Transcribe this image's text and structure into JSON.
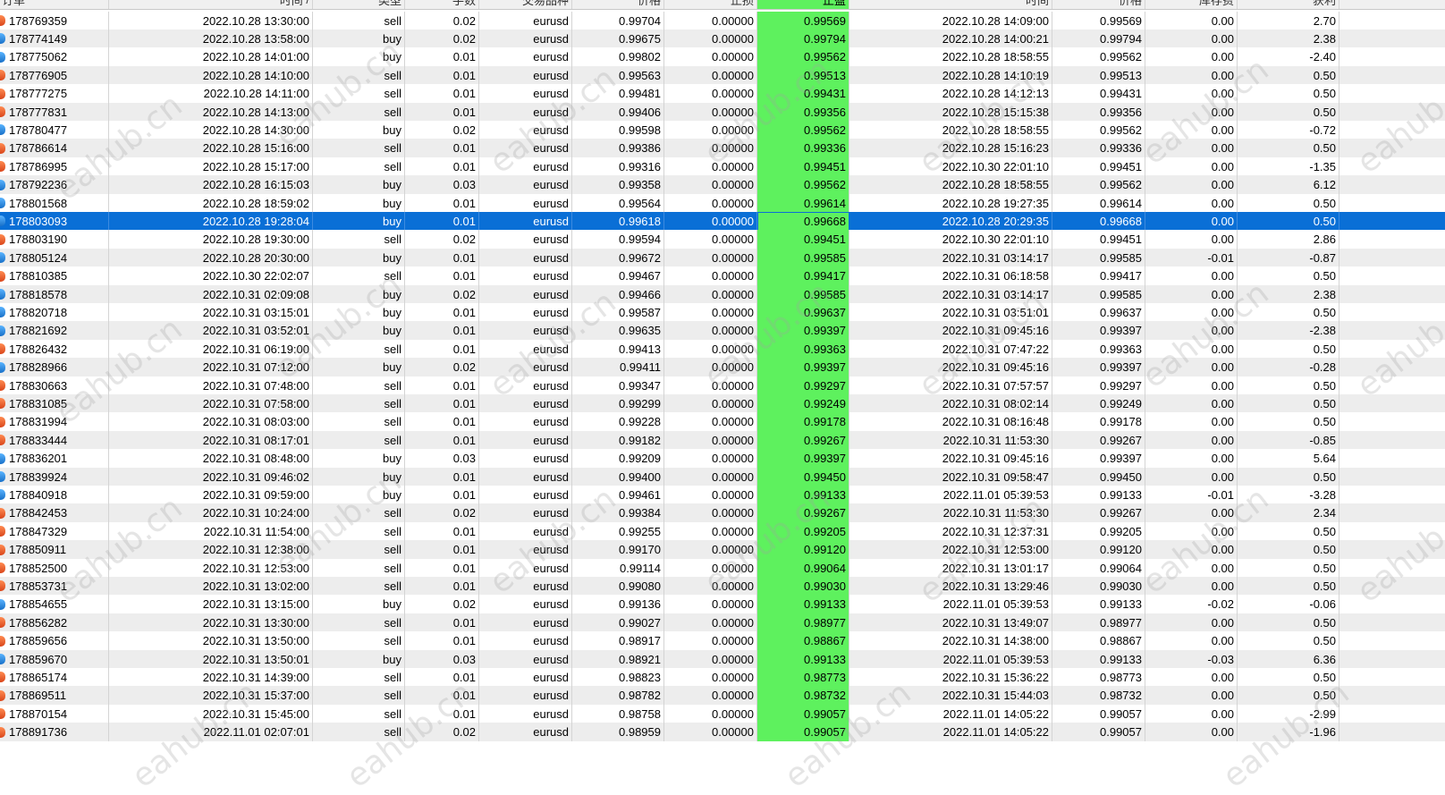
{
  "columns": [
    "订单",
    "时间",
    "类型",
    "手数",
    "交易品种",
    "价格",
    "止损",
    "止盈",
    "时间",
    "价格",
    "库存费",
    "获利",
    ""
  ],
  "columns_visible_note": "",
  "sort_indicator": "/",
  "selected_row_index": 11,
  "colors": {
    "takeprofit_bg": "#5ef15e",
    "selected_bg": "#0a6fd6",
    "sell_icon": "#e05a24",
    "buy_icon": "#2a86e0"
  },
  "watermark_text": "eahub.cn",
  "rows": [
    {
      "order": "178769359",
      "open_time": "2022.10.28 13:30:00",
      "type": "sell",
      "lots": "0.02",
      "symbol": "eurusd",
      "open_price": "0.99704",
      "sl": "0.00000",
      "tp": "0.99569",
      "close_time": "2022.10.28 14:09:00",
      "close_price": "0.99569",
      "swap": "0.00",
      "profit": "2.70"
    },
    {
      "order": "178774149",
      "open_time": "2022.10.28 13:58:00",
      "type": "buy",
      "lots": "0.02",
      "symbol": "eurusd",
      "open_price": "0.99675",
      "sl": "0.00000",
      "tp": "0.99794",
      "close_time": "2022.10.28 14:00:21",
      "close_price": "0.99794",
      "swap": "0.00",
      "profit": "2.38"
    },
    {
      "order": "178775062",
      "open_time": "2022.10.28 14:01:00",
      "type": "buy",
      "lots": "0.01",
      "symbol": "eurusd",
      "open_price": "0.99802",
      "sl": "0.00000",
      "tp": "0.99562",
      "close_time": "2022.10.28 18:58:55",
      "close_price": "0.99562",
      "swap": "0.00",
      "profit": "-2.40"
    },
    {
      "order": "178776905",
      "open_time": "2022.10.28 14:10:00",
      "type": "sell",
      "lots": "0.01",
      "symbol": "eurusd",
      "open_price": "0.99563",
      "sl": "0.00000",
      "tp": "0.99513",
      "close_time": "2022.10.28 14:10:19",
      "close_price": "0.99513",
      "swap": "0.00",
      "profit": "0.50"
    },
    {
      "order": "178777275",
      "open_time": "2022.10.28 14:11:00",
      "type": "sell",
      "lots": "0.01",
      "symbol": "eurusd",
      "open_price": "0.99481",
      "sl": "0.00000",
      "tp": "0.99431",
      "close_time": "2022.10.28 14:12:13",
      "close_price": "0.99431",
      "swap": "0.00",
      "profit": "0.50"
    },
    {
      "order": "178777831",
      "open_time": "2022.10.28 14:13:00",
      "type": "sell",
      "lots": "0.01",
      "symbol": "eurusd",
      "open_price": "0.99406",
      "sl": "0.00000",
      "tp": "0.99356",
      "close_time": "2022.10.28 15:15:38",
      "close_price": "0.99356",
      "swap": "0.00",
      "profit": "0.50"
    },
    {
      "order": "178780477",
      "open_time": "2022.10.28 14:30:00",
      "type": "buy",
      "lots": "0.02",
      "symbol": "eurusd",
      "open_price": "0.99598",
      "sl": "0.00000",
      "tp": "0.99562",
      "close_time": "2022.10.28 18:58:55",
      "close_price": "0.99562",
      "swap": "0.00",
      "profit": "-0.72"
    },
    {
      "order": "178786614",
      "open_time": "2022.10.28 15:16:00",
      "type": "sell",
      "lots": "0.01",
      "symbol": "eurusd",
      "open_price": "0.99386",
      "sl": "0.00000",
      "tp": "0.99336",
      "close_time": "2022.10.28 15:16:23",
      "close_price": "0.99336",
      "swap": "0.00",
      "profit": "0.50"
    },
    {
      "order": "178786995",
      "open_time": "2022.10.28 15:17:00",
      "type": "sell",
      "lots": "0.01",
      "symbol": "eurusd",
      "open_price": "0.99316",
      "sl": "0.00000",
      "tp": "0.99451",
      "close_time": "2022.10.30 22:01:10",
      "close_price": "0.99451",
      "swap": "0.00",
      "profit": "-1.35"
    },
    {
      "order": "178792236",
      "open_time": "2022.10.28 16:15:03",
      "type": "buy",
      "lots": "0.03",
      "symbol": "eurusd",
      "open_price": "0.99358",
      "sl": "0.00000",
      "tp": "0.99562",
      "close_time": "2022.10.28 18:58:55",
      "close_price": "0.99562",
      "swap": "0.00",
      "profit": "6.12"
    },
    {
      "order": "178801568",
      "open_time": "2022.10.28 18:59:02",
      "type": "buy",
      "lots": "0.01",
      "symbol": "eurusd",
      "open_price": "0.99564",
      "sl": "0.00000",
      "tp": "0.99614",
      "close_time": "2022.10.28 19:27:35",
      "close_price": "0.99614",
      "swap": "0.00",
      "profit": "0.50"
    },
    {
      "order": "178803093",
      "open_time": "2022.10.28 19:28:04",
      "type": "buy",
      "lots": "0.01",
      "symbol": "eurusd",
      "open_price": "0.99618",
      "sl": "0.00000",
      "tp": "0.99668",
      "close_time": "2022.10.28 20:29:35",
      "close_price": "0.99668",
      "swap": "0.00",
      "profit": "0.50"
    },
    {
      "order": "178803190",
      "open_time": "2022.10.28 19:30:00",
      "type": "sell",
      "lots": "0.02",
      "symbol": "eurusd",
      "open_price": "0.99594",
      "sl": "0.00000",
      "tp": "0.99451",
      "close_time": "2022.10.30 22:01:10",
      "close_price": "0.99451",
      "swap": "0.00",
      "profit": "2.86"
    },
    {
      "order": "178805124",
      "open_time": "2022.10.28 20:30:00",
      "type": "buy",
      "lots": "0.01",
      "symbol": "eurusd",
      "open_price": "0.99672",
      "sl": "0.00000",
      "tp": "0.99585",
      "close_time": "2022.10.31 03:14:17",
      "close_price": "0.99585",
      "swap": "-0.01",
      "profit": "-0.87"
    },
    {
      "order": "178810385",
      "open_time": "2022.10.30 22:02:07",
      "type": "sell",
      "lots": "0.01",
      "symbol": "eurusd",
      "open_price": "0.99467",
      "sl": "0.00000",
      "tp": "0.99417",
      "close_time": "2022.10.31 06:18:58",
      "close_price": "0.99417",
      "swap": "0.00",
      "profit": "0.50"
    },
    {
      "order": "178818578",
      "open_time": "2022.10.31 02:09:08",
      "type": "buy",
      "lots": "0.02",
      "symbol": "eurusd",
      "open_price": "0.99466",
      "sl": "0.00000",
      "tp": "0.99585",
      "close_time": "2022.10.31 03:14:17",
      "close_price": "0.99585",
      "swap": "0.00",
      "profit": "2.38"
    },
    {
      "order": "178820718",
      "open_time": "2022.10.31 03:15:01",
      "type": "buy",
      "lots": "0.01",
      "symbol": "eurusd",
      "open_price": "0.99587",
      "sl": "0.00000",
      "tp": "0.99637",
      "close_time": "2022.10.31 03:51:01",
      "close_price": "0.99637",
      "swap": "0.00",
      "profit": "0.50"
    },
    {
      "order": "178821692",
      "open_time": "2022.10.31 03:52:01",
      "type": "buy",
      "lots": "0.01",
      "symbol": "eurusd",
      "open_price": "0.99635",
      "sl": "0.00000",
      "tp": "0.99397",
      "close_time": "2022.10.31 09:45:16",
      "close_price": "0.99397",
      "swap": "0.00",
      "profit": "-2.38"
    },
    {
      "order": "178826432",
      "open_time": "2022.10.31 06:19:00",
      "type": "sell",
      "lots": "0.01",
      "symbol": "eurusd",
      "open_price": "0.99413",
      "sl": "0.00000",
      "tp": "0.99363",
      "close_time": "2022.10.31 07:47:22",
      "close_price": "0.99363",
      "swap": "0.00",
      "profit": "0.50"
    },
    {
      "order": "178828966",
      "open_time": "2022.10.31 07:12:00",
      "type": "buy",
      "lots": "0.02",
      "symbol": "eurusd",
      "open_price": "0.99411",
      "sl": "0.00000",
      "tp": "0.99397",
      "close_time": "2022.10.31 09:45:16",
      "close_price": "0.99397",
      "swap": "0.00",
      "profit": "-0.28"
    },
    {
      "order": "178830663",
      "open_time": "2022.10.31 07:48:00",
      "type": "sell",
      "lots": "0.01",
      "symbol": "eurusd",
      "open_price": "0.99347",
      "sl": "0.00000",
      "tp": "0.99297",
      "close_time": "2022.10.31 07:57:57",
      "close_price": "0.99297",
      "swap": "0.00",
      "profit": "0.50"
    },
    {
      "order": "178831085",
      "open_time": "2022.10.31 07:58:00",
      "type": "sell",
      "lots": "0.01",
      "symbol": "eurusd",
      "open_price": "0.99299",
      "sl": "0.00000",
      "tp": "0.99249",
      "close_time": "2022.10.31 08:02:14",
      "close_price": "0.99249",
      "swap": "0.00",
      "profit": "0.50"
    },
    {
      "order": "178831994",
      "open_time": "2022.10.31 08:03:00",
      "type": "sell",
      "lots": "0.01",
      "symbol": "eurusd",
      "open_price": "0.99228",
      "sl": "0.00000",
      "tp": "0.99178",
      "close_time": "2022.10.31 08:16:48",
      "close_price": "0.99178",
      "swap": "0.00",
      "profit": "0.50"
    },
    {
      "order": "178833444",
      "open_time": "2022.10.31 08:17:01",
      "type": "sell",
      "lots": "0.01",
      "symbol": "eurusd",
      "open_price": "0.99182",
      "sl": "0.00000",
      "tp": "0.99267",
      "close_time": "2022.10.31 11:53:30",
      "close_price": "0.99267",
      "swap": "0.00",
      "profit": "-0.85"
    },
    {
      "order": "178836201",
      "open_time": "2022.10.31 08:48:00",
      "type": "buy",
      "lots": "0.03",
      "symbol": "eurusd",
      "open_price": "0.99209",
      "sl": "0.00000",
      "tp": "0.99397",
      "close_time": "2022.10.31 09:45:16",
      "close_price": "0.99397",
      "swap": "0.00",
      "profit": "5.64"
    },
    {
      "order": "178839924",
      "open_time": "2022.10.31 09:46:02",
      "type": "buy",
      "lots": "0.01",
      "symbol": "eurusd",
      "open_price": "0.99400",
      "sl": "0.00000",
      "tp": "0.99450",
      "close_time": "2022.10.31 09:58:47",
      "close_price": "0.99450",
      "swap": "0.00",
      "profit": "0.50"
    },
    {
      "order": "178840918",
      "open_time": "2022.10.31 09:59:00",
      "type": "buy",
      "lots": "0.01",
      "symbol": "eurusd",
      "open_price": "0.99461",
      "sl": "0.00000",
      "tp": "0.99133",
      "close_time": "2022.11.01 05:39:53",
      "close_price": "0.99133",
      "swap": "-0.01",
      "profit": "-3.28"
    },
    {
      "order": "178842453",
      "open_time": "2022.10.31 10:24:00",
      "type": "sell",
      "lots": "0.02",
      "symbol": "eurusd",
      "open_price": "0.99384",
      "sl": "0.00000",
      "tp": "0.99267",
      "close_time": "2022.10.31 11:53:30",
      "close_price": "0.99267",
      "swap": "0.00",
      "profit": "2.34"
    },
    {
      "order": "178847329",
      "open_time": "2022.10.31 11:54:00",
      "type": "sell",
      "lots": "0.01",
      "symbol": "eurusd",
      "open_price": "0.99255",
      "sl": "0.00000",
      "tp": "0.99205",
      "close_time": "2022.10.31 12:37:31",
      "close_price": "0.99205",
      "swap": "0.00",
      "profit": "0.50"
    },
    {
      "order": "178850911",
      "open_time": "2022.10.31 12:38:00",
      "type": "sell",
      "lots": "0.01",
      "symbol": "eurusd",
      "open_price": "0.99170",
      "sl": "0.00000",
      "tp": "0.99120",
      "close_time": "2022.10.31 12:53:00",
      "close_price": "0.99120",
      "swap": "0.00",
      "profit": "0.50"
    },
    {
      "order": "178852500",
      "open_time": "2022.10.31 12:53:00",
      "type": "sell",
      "lots": "0.01",
      "symbol": "eurusd",
      "open_price": "0.99114",
      "sl": "0.00000",
      "tp": "0.99064",
      "close_time": "2022.10.31 13:01:17",
      "close_price": "0.99064",
      "swap": "0.00",
      "profit": "0.50"
    },
    {
      "order": "178853731",
      "open_time": "2022.10.31 13:02:00",
      "type": "sell",
      "lots": "0.01",
      "symbol": "eurusd",
      "open_price": "0.99080",
      "sl": "0.00000",
      "tp": "0.99030",
      "close_time": "2022.10.31 13:29:46",
      "close_price": "0.99030",
      "swap": "0.00",
      "profit": "0.50"
    },
    {
      "order": "178854655",
      "open_time": "2022.10.31 13:15:00",
      "type": "buy",
      "lots": "0.02",
      "symbol": "eurusd",
      "open_price": "0.99136",
      "sl": "0.00000",
      "tp": "0.99133",
      "close_time": "2022.11.01 05:39:53",
      "close_price": "0.99133",
      "swap": "-0.02",
      "profit": "-0.06"
    },
    {
      "order": "178856282",
      "open_time": "2022.10.31 13:30:00",
      "type": "sell",
      "lots": "0.01",
      "symbol": "eurusd",
      "open_price": "0.99027",
      "sl": "0.00000",
      "tp": "0.98977",
      "close_time": "2022.10.31 13:49:07",
      "close_price": "0.98977",
      "swap": "0.00",
      "profit": "0.50"
    },
    {
      "order": "178859656",
      "open_time": "2022.10.31 13:50:00",
      "type": "sell",
      "lots": "0.01",
      "symbol": "eurusd",
      "open_price": "0.98917",
      "sl": "0.00000",
      "tp": "0.98867",
      "close_time": "2022.10.31 14:38:00",
      "close_price": "0.98867",
      "swap": "0.00",
      "profit": "0.50"
    },
    {
      "order": "178859670",
      "open_time": "2022.10.31 13:50:01",
      "type": "buy",
      "lots": "0.03",
      "symbol": "eurusd",
      "open_price": "0.98921",
      "sl": "0.00000",
      "tp": "0.99133",
      "close_time": "2022.11.01 05:39:53",
      "close_price": "0.99133",
      "swap": "-0.03",
      "profit": "6.36"
    },
    {
      "order": "178865174",
      "open_time": "2022.10.31 14:39:00",
      "type": "sell",
      "lots": "0.01",
      "symbol": "eurusd",
      "open_price": "0.98823",
      "sl": "0.00000",
      "tp": "0.98773",
      "close_time": "2022.10.31 15:36:22",
      "close_price": "0.98773",
      "swap": "0.00",
      "profit": "0.50"
    },
    {
      "order": "178869511",
      "open_time": "2022.10.31 15:37:00",
      "type": "sell",
      "lots": "0.01",
      "symbol": "eurusd",
      "open_price": "0.98782",
      "sl": "0.00000",
      "tp": "0.98732",
      "close_time": "2022.10.31 15:44:03",
      "close_price": "0.98732",
      "swap": "0.00",
      "profit": "0.50"
    },
    {
      "order": "178870154",
      "open_time": "2022.10.31 15:45:00",
      "type": "sell",
      "lots": "0.01",
      "symbol": "eurusd",
      "open_price": "0.98758",
      "sl": "0.00000",
      "tp": "0.99057",
      "close_time": "2022.11.01 14:05:22",
      "close_price": "0.99057",
      "swap": "0.00",
      "profit": "-2.99"
    },
    {
      "order": "178891736",
      "open_time": "2022.11.01 02:07:01",
      "type": "sell",
      "lots": "0.02",
      "symbol": "eurusd",
      "open_price": "0.98959",
      "sl": "0.00000",
      "tp": "0.99057",
      "close_time": "2022.11.01 14:05:22",
      "close_price": "0.99057",
      "swap": "0.00",
      "profit": "-1.96"
    }
  ]
}
